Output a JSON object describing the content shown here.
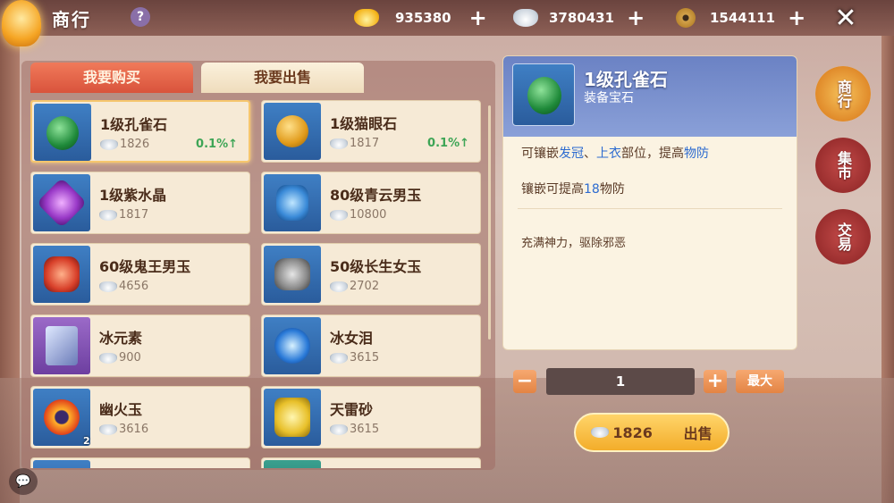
{
  "header": {
    "title": "商行",
    "help": "?",
    "currencies": [
      {
        "icon": "gold-ingot-icon",
        "value": "935380"
      },
      {
        "icon": "silver-ingot-icon",
        "value": "3780431"
      },
      {
        "icon": "copper-coin-icon",
        "value": "1544111"
      }
    ],
    "plus": "+",
    "close": "✕"
  },
  "tabs": {
    "buy": "我要购买",
    "sell": "我要出售"
  },
  "items": [
    {
      "name": "1级孔雀石",
      "price": "1826",
      "change": "0.1%↑",
      "icon": "peacock-stone-icon"
    },
    {
      "name": "1级猫眼石",
      "price": "1817",
      "change": "0.1%↑",
      "icon": "cats-eye-stone-icon"
    },
    {
      "name": "1级紫水晶",
      "price": "1817",
      "change": "",
      "icon": "amethyst-icon"
    },
    {
      "name": "80级青云男玉",
      "price": "10800",
      "change": "",
      "icon": "jade-icon"
    },
    {
      "name": "60级鬼王男玉",
      "price": "4656",
      "change": "",
      "icon": "red-jade-icon"
    },
    {
      "name": "50级长生女玉",
      "price": "2702",
      "change": "",
      "icon": "yin-yang-jade-icon"
    },
    {
      "name": "冰元素",
      "price": "900",
      "change": "",
      "icon": "ice-book-icon"
    },
    {
      "name": "冰女泪",
      "price": "3615",
      "change": "",
      "icon": "ice-tear-icon"
    },
    {
      "name": "幽火玉",
      "price": "3616",
      "change": "",
      "icon": "fire-ring-icon",
      "badge": "2"
    },
    {
      "name": "天雷砂",
      "price": "3615",
      "change": "",
      "icon": "thunder-sand-icon"
    }
  ],
  "detail": {
    "name": "1级孔雀石",
    "type": "装备宝石",
    "line1_pre": "可镶嵌",
    "line1_a": "发冠",
    "line1_sep": "、",
    "line1_b": "上衣",
    "line1_mid": "部位，提高",
    "line1_c": "物防",
    "line2_pre": "镶嵌可提高",
    "line2_num": "18",
    "line2_post": "物防",
    "desc": "充满神力，驱除邪恶"
  },
  "quantity": {
    "minus": "−",
    "value": "1",
    "plus": "+",
    "max": "最大"
  },
  "sell": {
    "price": "1826",
    "label": "出售"
  },
  "side_nav": [
    "商行",
    "集市",
    "交易"
  ],
  "chat": "💬"
}
